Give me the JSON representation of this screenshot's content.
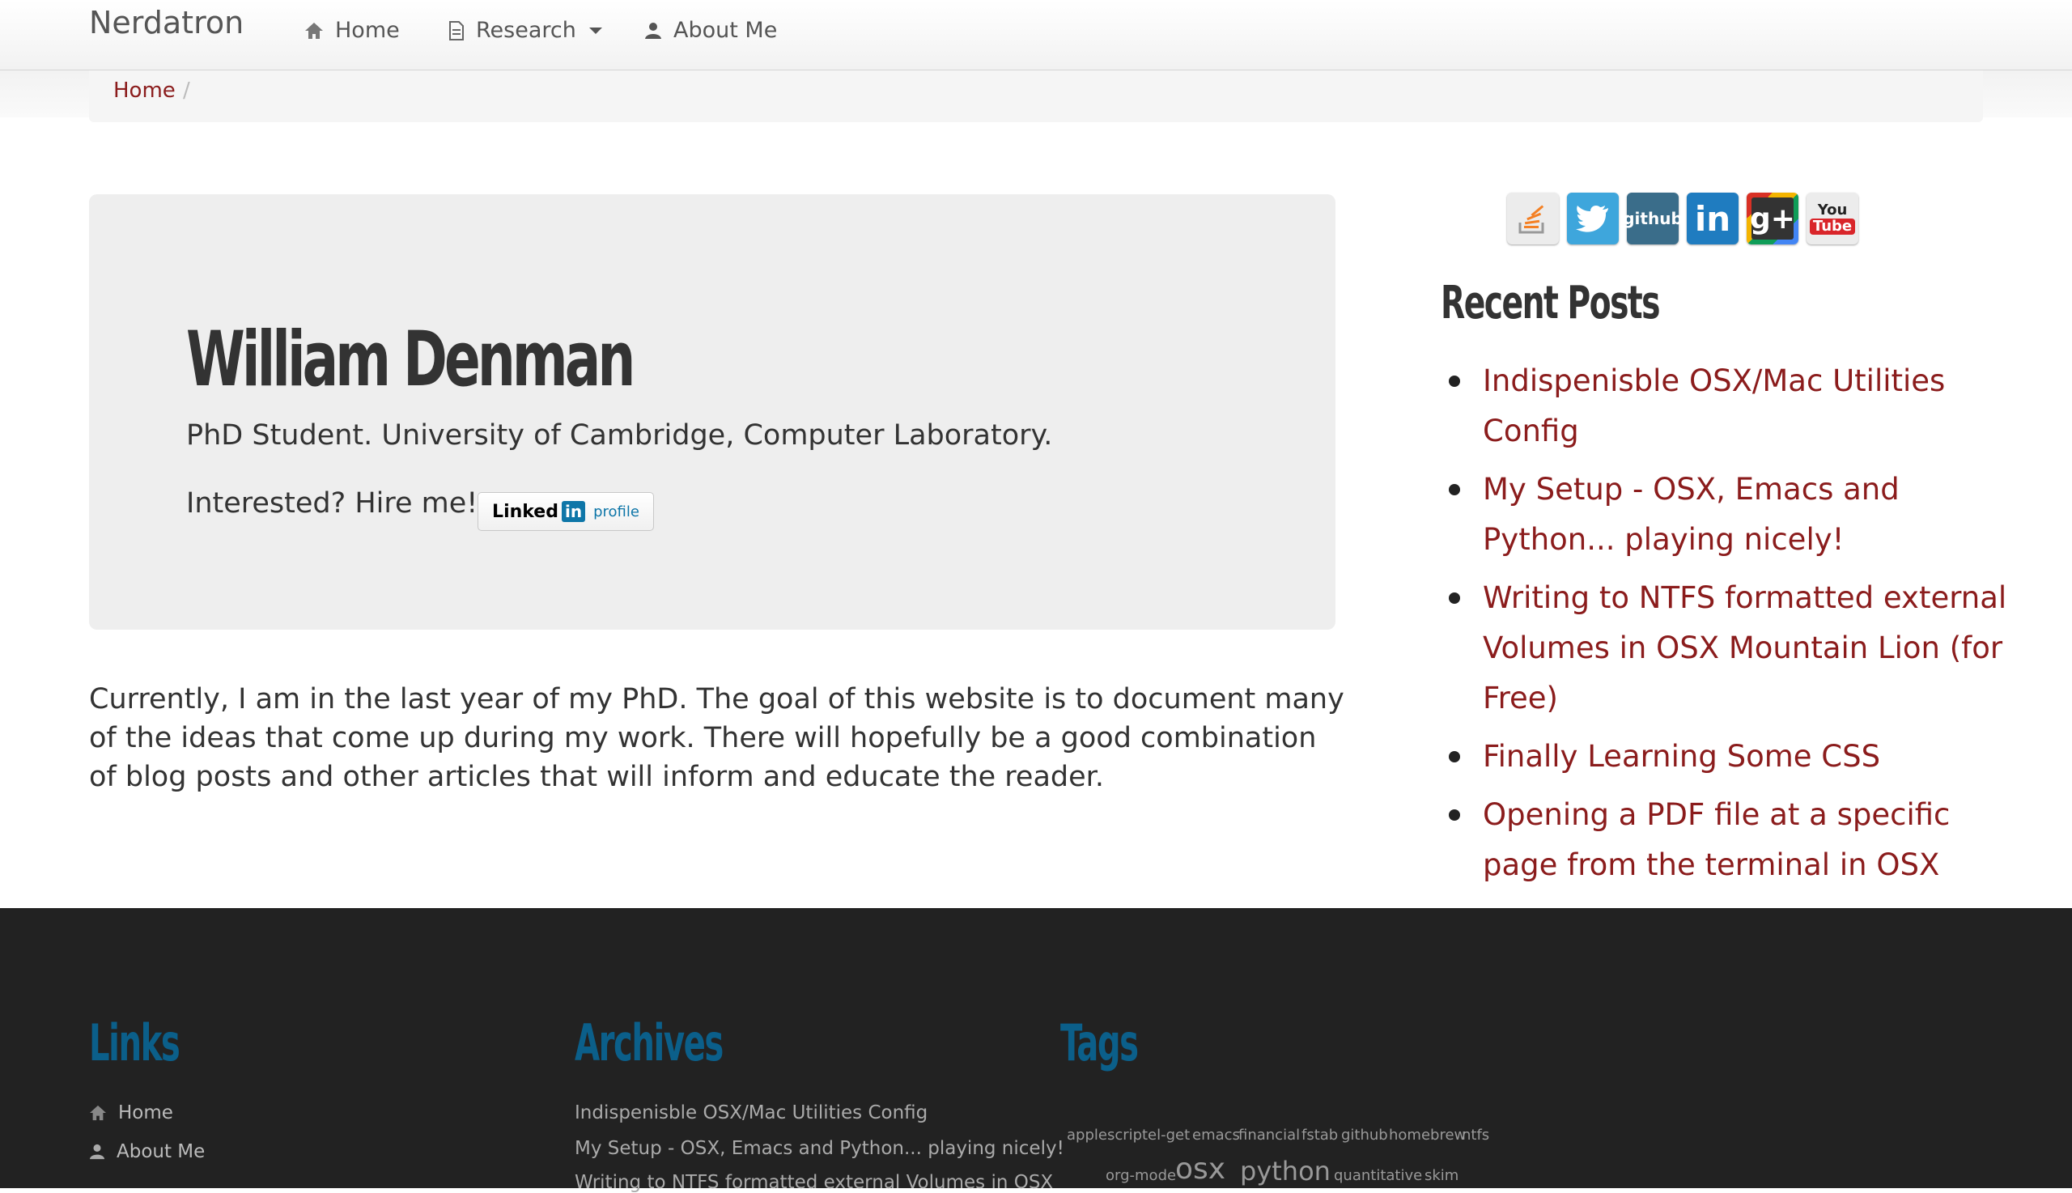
{
  "navbar": {
    "brand": "Nerdatron",
    "items": [
      {
        "label": "Home",
        "icon": "home-icon"
      },
      {
        "label": "Research",
        "icon": "document-icon"
      },
      {
        "label": "About Me",
        "icon": "user-icon"
      }
    ]
  },
  "breadcrumb": {
    "home": "Home",
    "separator": "/"
  },
  "hero": {
    "title": "William Denman",
    "subtitle": "PhD Student. University of Cambridge, Computer Laboratory.",
    "hire_text": "Interested? Hire me!",
    "badge": {
      "linked": "Linked",
      "in": "in",
      "profile": "profile"
    }
  },
  "intro": "Currently, I am in the last year of my PhD. The goal of this website is to document many of the ideas that come up during my work. There will hopefully be a good combination of blog posts and other articles that will inform and educate the reader.",
  "social": [
    {
      "name": "stackoverflow-icon",
      "color": "#e8e8e8"
    },
    {
      "name": "twitter-icon",
      "color": "#3ea6dc"
    },
    {
      "name": "github-icon",
      "label": "github",
      "color": "#3a6d8a"
    },
    {
      "name": "linkedin-icon",
      "label": "in",
      "color": "#1f7cc0"
    },
    {
      "name": "googleplus-icon",
      "label": "g+",
      "color": "#333333"
    },
    {
      "name": "youtube-icon",
      "label": "You Tube",
      "color": "#e8e8e8"
    }
  ],
  "recent_posts": {
    "title": "Recent Posts",
    "items": [
      "Indispenisble OSX/Mac Utilities Config",
      "My Setup - OSX, Emacs and Python... playing nicely!",
      "Writing to NTFS formatted external Volumes in OSX Mountain Lion (for Free)",
      "Finally Learning Some CSS",
      "Opening a PDF file at a specific page from the terminal in OSX"
    ]
  },
  "footer": {
    "links_title": "Links",
    "links": [
      {
        "label": "Home",
        "icon": "home-icon"
      },
      {
        "label": "About Me",
        "icon": "user-icon"
      }
    ],
    "archives_title": "Archives",
    "archives": [
      "Indispenisble OSX/Mac Utilities Config",
      "My Setup - OSX, Emacs and Python... playing nicely!",
      "Writing to NTFS formatted external Volumes in OSX"
    ],
    "tags_title": "Tags",
    "tags": [
      "applescript",
      "el-get",
      "emacs",
      "financial",
      "fstab",
      "github",
      "homebrew",
      "ntfs",
      "org-mode",
      "osx",
      "python",
      "quantitative",
      "skim"
    ]
  },
  "colors": {
    "accent": "#8b1c1c",
    "footer_heading": "#0b5f8a",
    "footer_bg": "#222222"
  }
}
